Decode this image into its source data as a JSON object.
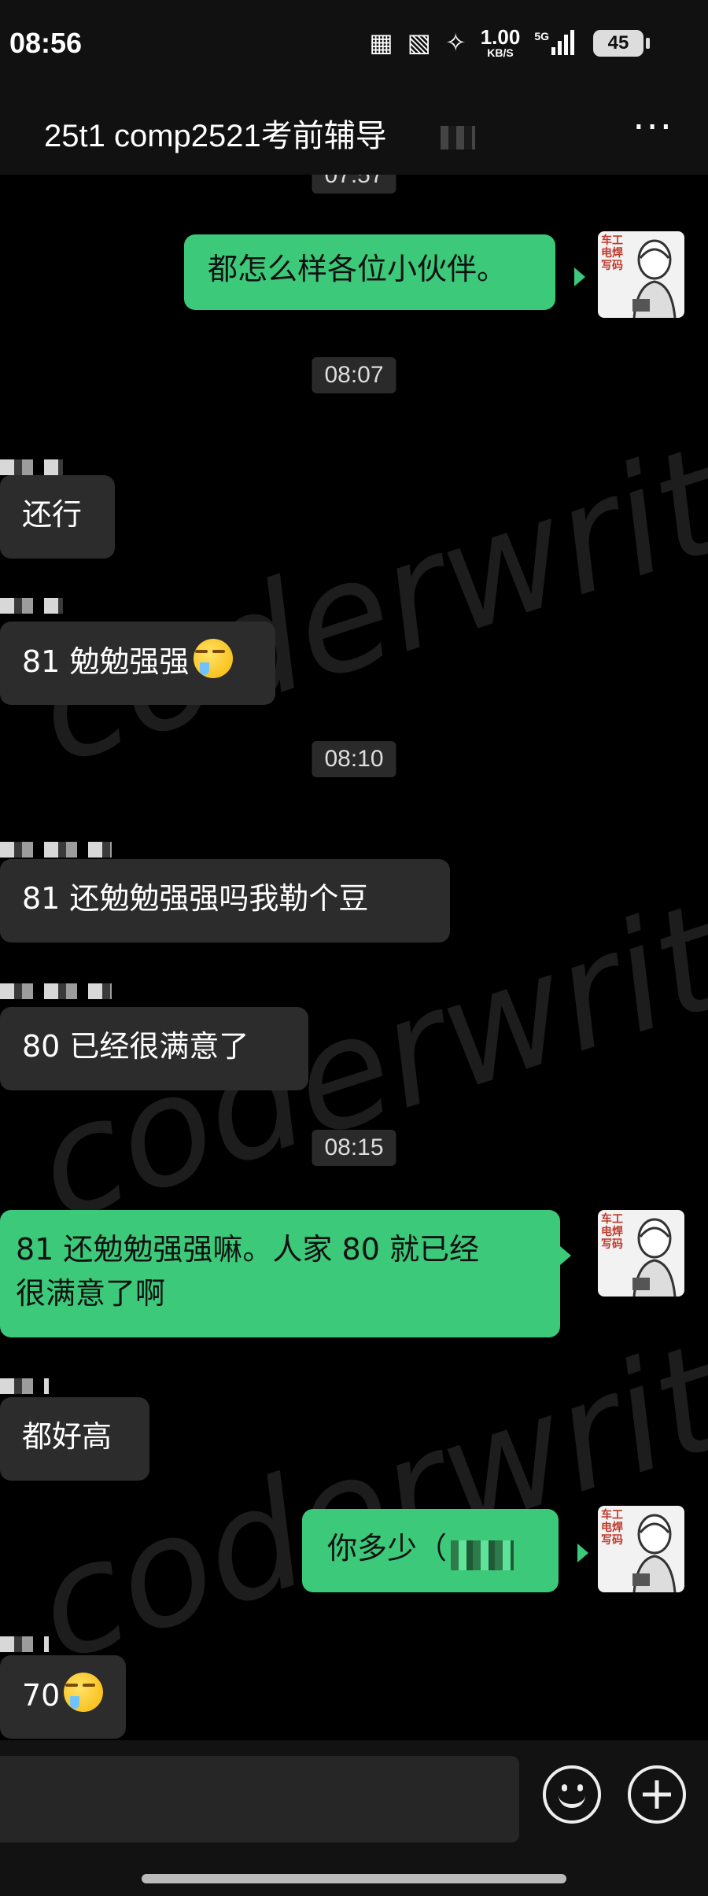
{
  "status_bar": {
    "time": "08:56",
    "net_speed_value": "1.00",
    "net_speed_unit": "KB/S",
    "signal_label": "5G",
    "battery": "45"
  },
  "header": {
    "title": "25t1 comp2521考前辅导",
    "more_label": "···"
  },
  "chat": {
    "top_time_partial": "07:57",
    "avatar_tag": "车工电焊写码",
    "watermark": "coderwrite",
    "messages": [
      {
        "type": "out",
        "text": "都怎么样各位小伙伴。"
      },
      {
        "type": "time",
        "text": "08:07"
      },
      {
        "type": "in",
        "text": "还行"
      },
      {
        "type": "in",
        "text": "81 勉勉强强"
      },
      {
        "type": "time",
        "text": "08:10"
      },
      {
        "type": "in",
        "text": "81 还勉勉强强吗我勒个豆"
      },
      {
        "type": "in",
        "text": "80 已经很满意了"
      },
      {
        "type": "time",
        "text": "08:15"
      },
      {
        "type": "out",
        "text_line1": "81 还勉勉强强嘛。人家 80 就已经",
        "text_line2": "很满意了啊"
      },
      {
        "type": "in",
        "text": "都好高"
      },
      {
        "type": "out",
        "text": "你多少（"
      },
      {
        "type": "in",
        "text": "70"
      }
    ]
  },
  "icons": {
    "nfc": "nfc-icon",
    "vibrate": "vibrate-icon",
    "bluetooth": "bluetooth-icon",
    "signal": "signal-icon",
    "emoji": "emoji-icon",
    "plus": "plus-icon"
  },
  "colors": {
    "outgoing_bubble": "#3cc97a",
    "incoming_bubble": "#2c2c2c",
    "background": "#000000"
  }
}
